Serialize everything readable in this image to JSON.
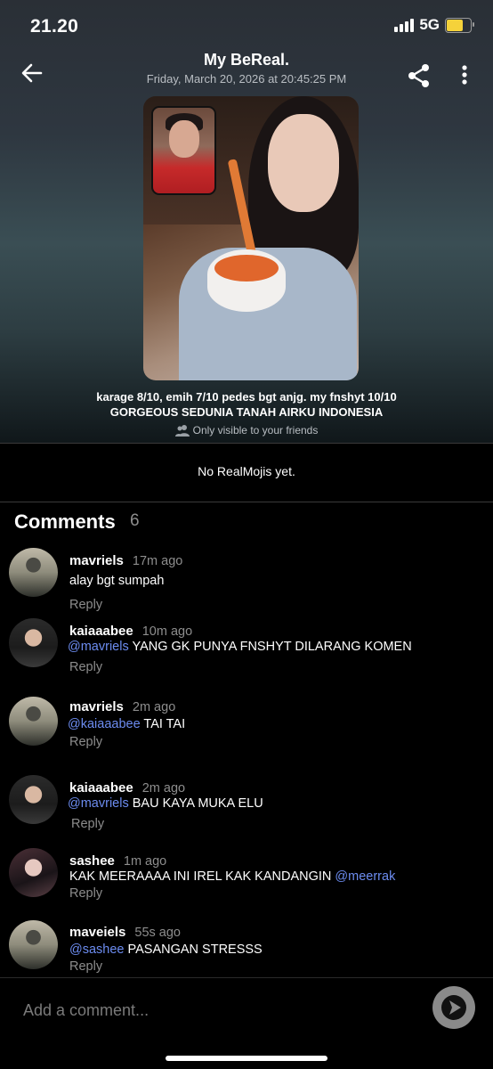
{
  "status_bar": {
    "time": "21.20",
    "network": "5G",
    "battery_color": "#f5d23a"
  },
  "header": {
    "title": "My BeReal.",
    "subtitle": "Friday, March 20, 2026 at 20:45:25 PM",
    "back_icon": "arrow-left-icon",
    "share_icon": "share-icon",
    "more_icon": "more-vertical-icon"
  },
  "post": {
    "caption_line1": "karage 8/10, emih 7/10 pedes bgt anjg. my fnshyt 10/10",
    "caption_line2": "GORGEOUS SEDUNIA TANAH AIRKU INDONESIA",
    "visibility": "Only visible to your friends"
  },
  "realmojis": {
    "empty_text": "No RealMojis yet."
  },
  "comments": {
    "title": "Comments",
    "count": "6",
    "items": [
      {
        "user": "mavriels",
        "time": "17m ago",
        "mention": "",
        "text": "alay bgt sumpah",
        "mention_after": "",
        "reply": "Reply"
      },
      {
        "user": "kaiaaabee",
        "time": "10m ago",
        "mention": "@mavriels",
        "text": " YANG GK PUNYA FNSHYT DILARANG KOMEN",
        "mention_after": "",
        "reply": "Reply"
      },
      {
        "user": "mavriels",
        "time": "2m ago",
        "mention": "@kaiaaabee",
        "text": " TAI TAI",
        "mention_after": "",
        "reply": "Reply"
      },
      {
        "user": "kaiaaabee",
        "time": "2m ago",
        "mention": "@mavriels",
        "text": "  BAU KAYA MUKA ELU",
        "mention_after": "",
        "reply": "Reply"
      },
      {
        "user": "sashee",
        "time": "1m ago",
        "mention": "",
        "text": "KAK MEERAAAA INI IREL KAK KANDANGIN ",
        "mention_after": "@meerrak",
        "reply": "Reply"
      },
      {
        "user": "maveiels",
        "time": "55s ago",
        "mention": "@sashee",
        "text": " PASANGAN STRESSS",
        "mention_after": "",
        "reply": "Reply"
      }
    ]
  },
  "composer": {
    "placeholder": "Add a comment...",
    "send_icon": "send-icon"
  },
  "colors": {
    "mention": "#6c8cf0",
    "muted": "#8d8d8d",
    "background": "#000000"
  }
}
